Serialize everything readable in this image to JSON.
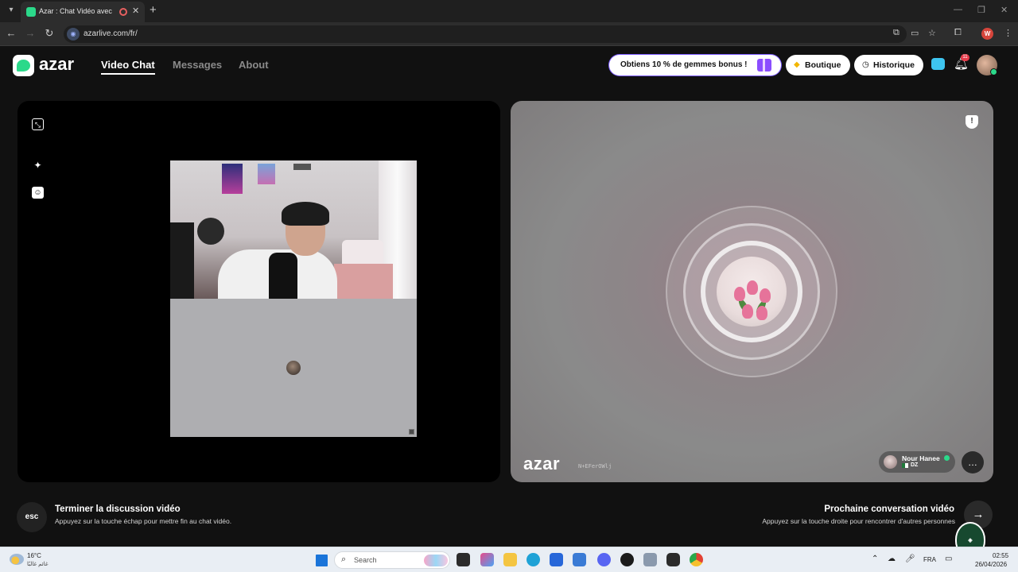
{
  "browser": {
    "tab_title": "Azar : Chat Vidéo avec de n",
    "tab_close": "✕",
    "new_tab": "+",
    "url": "azarlive.com/fr/",
    "profile_initial": "W"
  },
  "header": {
    "logo_text": "azar",
    "nav": [
      "Video Chat",
      "Messages",
      "About"
    ],
    "promo_text": "Obtiens 10 % de gemmes bonus !",
    "shop_label": "Boutique",
    "history_label": "Historique",
    "notification_count": "11"
  },
  "remote": {
    "logo_text": "azar",
    "session_id": "N+EFerOWlj",
    "user_name": "Nour Hanee",
    "user_country": "DZ"
  },
  "controls": {
    "esc_label": "esc",
    "end_title": "Terminer la discussion vidéo",
    "end_sub": "Appuyez sur la touche échap pour mettre fin au chat vidéo.",
    "next_title": "Prochaine conversation vidéo",
    "next_sub": "Appuyez sur la touche droite pour rencontrer d'autres personnes"
  },
  "taskbar": {
    "temperature": "16°C",
    "weather_desc": "غائم غالبًا",
    "search_placeholder": "Search",
    "language": "FRA",
    "time": "02:55",
    "date": "26/04/2026"
  },
  "colors": {
    "accent": "#2bd98a",
    "promo_border": "#7c5cff",
    "notification_badge": "#e53b4a"
  },
  "icons": [
    "expand-icon",
    "magic-wand-icon",
    "sticker-icon",
    "report-icon",
    "message-icon",
    "arrow-right-icon",
    "bell-icon",
    "chat-icon"
  ]
}
